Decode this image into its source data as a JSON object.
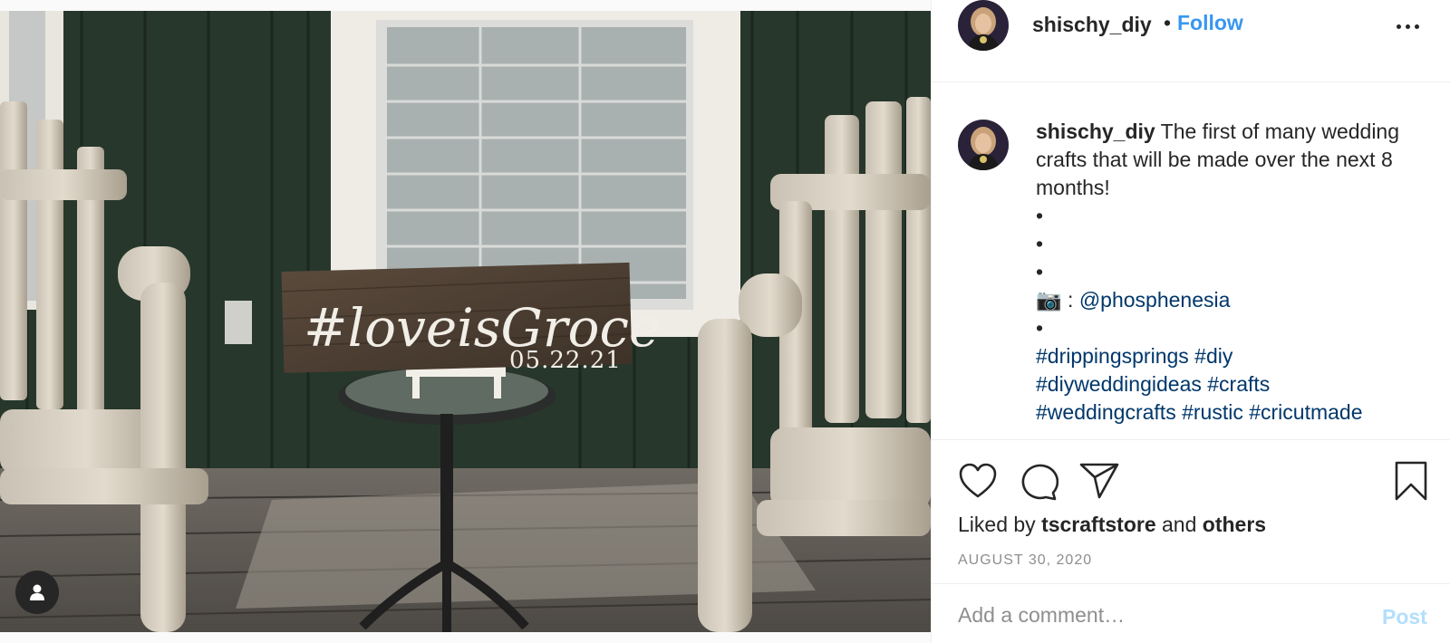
{
  "post": {
    "image_alt": "Wooden sign reading #loveisGroce 05.22.21 on a porch table between two rustic log chairs",
    "sign_text": "#loveisGroce",
    "sign_date": "05.22.21",
    "tag_icon": "user-tag-icon"
  },
  "header": {
    "username": "shischy_diy",
    "separator": "•",
    "follow_label": "Follow",
    "more_icon": "more-options-icon"
  },
  "caption": {
    "username": "shischy_diy",
    "text": " The first of many wedding crafts that will be made over the next 8 months!",
    "bullet": "•",
    "camera_emoji": "📷",
    "credit_sep": " : ",
    "credit_handle": "@phosphenesia",
    "hashtags_line1": [
      "#drippingsprings",
      "#diy"
    ],
    "hashtags_line2": [
      "#diyweddingideas",
      "#crafts"
    ],
    "hashtags_line3": [
      "#weddingcrafts",
      "#rustic",
      "#cricutmade"
    ]
  },
  "actions": {
    "like_icon": "heart-icon",
    "comment_icon": "comment-icon",
    "share_icon": "share-icon",
    "save_icon": "bookmark-icon",
    "liked_by_prefix": "Liked by ",
    "liked_by_user": "tscraftstore",
    "liked_by_and": " and ",
    "liked_by_others": "others",
    "date": "AUGUST 30, 2020"
  },
  "comment": {
    "placeholder": "Add a comment…",
    "post_label": "Post"
  },
  "colors": {
    "link": "#00376b",
    "follow": "#3897f0",
    "post_disabled": "#b2dffc",
    "muted": "#8e8e8e",
    "text": "#262626"
  }
}
